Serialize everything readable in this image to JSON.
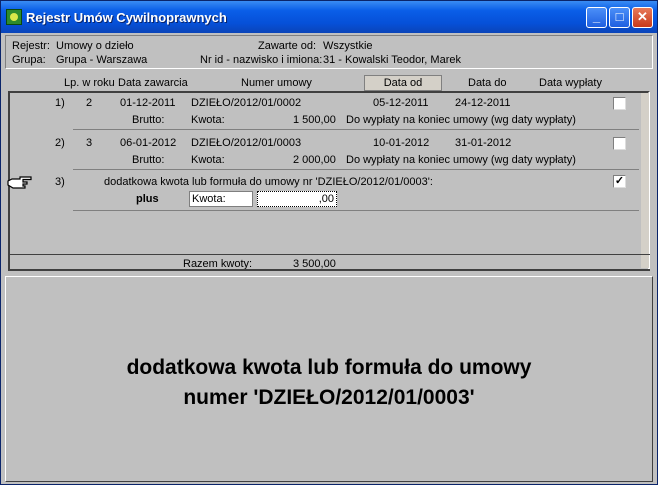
{
  "window": {
    "title": "Rejestr Umów Cywilnoprawnych"
  },
  "titlebar_buttons": {
    "minimize": "_",
    "maximize": "□",
    "close": "✕"
  },
  "info": {
    "register_label": "Rejestr:",
    "register_value": "Umowy o dzieło",
    "concluded_label": "Zawarte od:",
    "concluded_value": "Wszystkie",
    "group_label": "Grupa:",
    "group_value": "Grupa - Warszawa",
    "person_label": "Nr id - nazwisko i imiona:",
    "person_value": "31 - Kowalski Teodor, Marek"
  },
  "columns": {
    "lp": "Lp. w roku",
    "date_concluded": "Data zawarcia",
    "contract_number": "Numer umowy",
    "date_from": "Data od",
    "date_to": "Data do",
    "payment_date": "Data wypłaty"
  },
  "rows": [
    {
      "idx": "1)",
      "lp": "2",
      "date": "01-12-2011",
      "number": "DZIEŁO/2012/01/0002",
      "from": "05-12-2011",
      "to": "24-12-2011",
      "gross_label": "Brutto:",
      "amount_label": "Kwota:",
      "amount": "1 500,00",
      "payout": "Do wypłaty na koniec umowy (wg daty wypłaty)",
      "checked": ""
    },
    {
      "idx": "2)",
      "lp": "3",
      "date": "06-01-2012",
      "number": "DZIEŁO/2012/01/0003",
      "from": "10-01-2012",
      "to": "31-01-2012",
      "gross_label": "Brutto:",
      "amount_label": "Kwota:",
      "amount": "2 000,00",
      "payout": "Do wypłaty na koniec umowy (wg daty wypłaty)",
      "checked": ""
    }
  ],
  "extra": {
    "idx": "3)",
    "label": "dodatkowa kwota lub formuła do umowy nr 'DZIEŁO/2012/01/0003':",
    "checked": "✓",
    "plus": "plus",
    "kwota_label": "Kwota:",
    "kwota_value": ",00"
  },
  "total": {
    "label": "Razem kwoty:",
    "value": "3 500,00"
  },
  "preview": {
    "line1": "dodatkowa kwota lub formuła do umowy",
    "line2": "numer 'DZIEŁO/2012/01/0003'"
  },
  "colors": {
    "titlebar": "#0a5ee8",
    "panel": "#c0c0c0"
  }
}
